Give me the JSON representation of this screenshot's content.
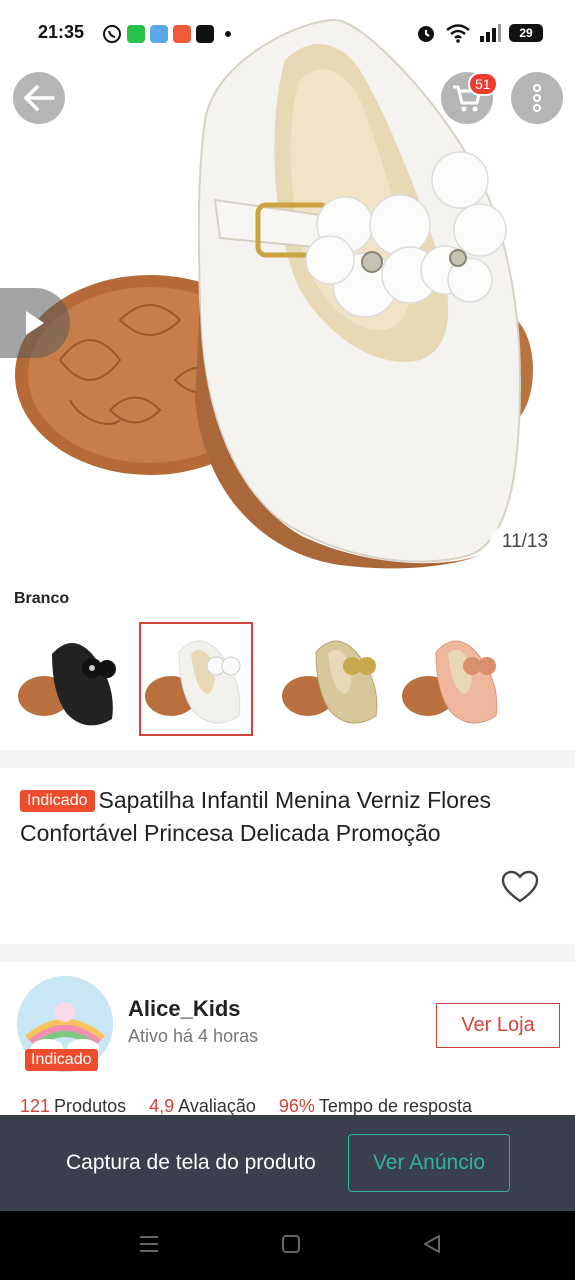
{
  "status_bar": {
    "time": "21:35",
    "battery": "29",
    "icons": [
      "whatsapp-icon",
      "app-icon",
      "app-icon",
      "app-icon",
      "app-icon",
      "alarm-icon",
      "wifi-icon",
      "signal-icon",
      "battery-icon"
    ]
  },
  "gallery": {
    "counter": "11/13",
    "cart_count": "51"
  },
  "variants": {
    "label": "Branco",
    "options": [
      "black",
      "white",
      "gold",
      "rose"
    ],
    "selected_index": 1
  },
  "product": {
    "tag": "Indicado",
    "title": "Sapatilha Infantil Menina Verniz Flores Confortável Princesa Delicada Promoção"
  },
  "shop": {
    "avatar_tag": "Indicado",
    "name": "Alice_Kids",
    "active": "Ativo há 4 horas",
    "button": "Ver Loja",
    "stats": [
      {
        "value": "121",
        "label": "Produtos"
      },
      {
        "value": "4,9",
        "label": "Avaliação"
      },
      {
        "value": "96%",
        "label": "Tempo de resposta"
      }
    ]
  },
  "capture": {
    "text": "Captura de tela do produto",
    "button": "Ver Anúncio"
  },
  "colors": {
    "accent": "#ee4d2d",
    "teal": "#2fb3a1",
    "dark_bar": "#3a3f4e"
  }
}
